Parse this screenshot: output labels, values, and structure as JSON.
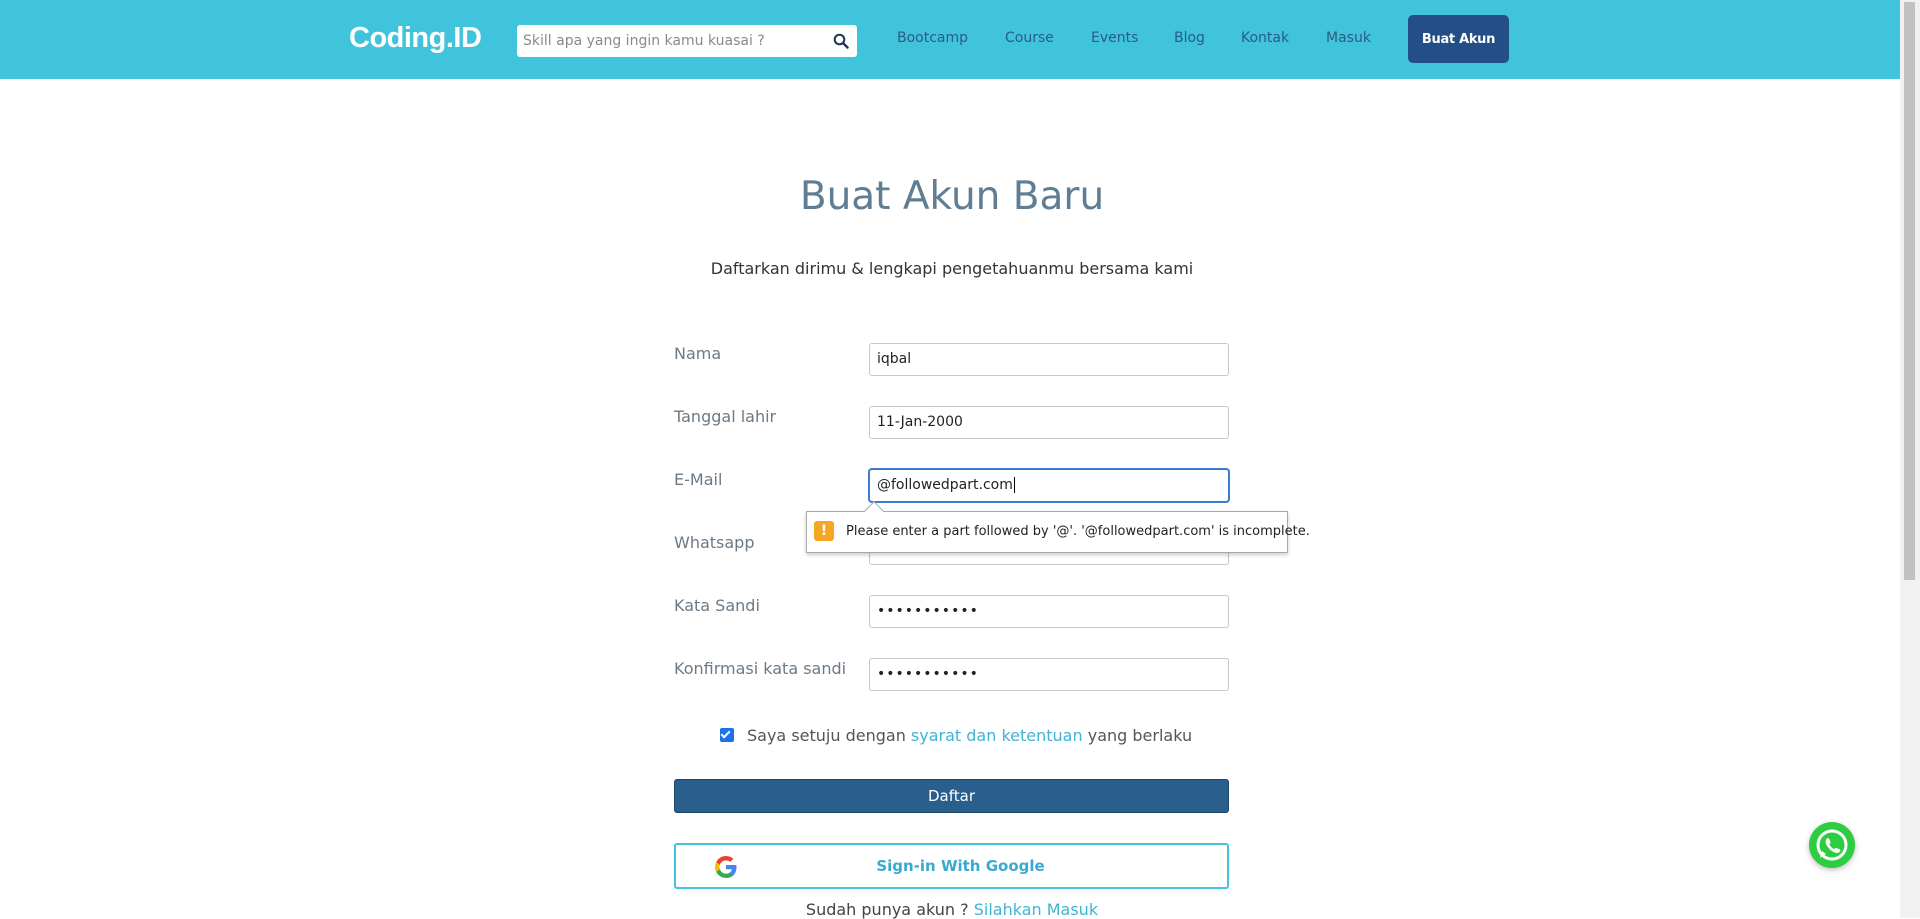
{
  "header": {
    "logo": "Coding.ID",
    "search_placeholder": "Skill apa yang ingin kamu kuasai ?",
    "nav": [
      "Bootcamp",
      "Course",
      "Events",
      "Blog",
      "Kontak",
      "Masuk"
    ],
    "cta": "Buat Akun"
  },
  "main": {
    "title": "Buat Akun Baru",
    "subtitle": "Daftarkan dirimu & lengkapi pengetahuanmu bersama kami",
    "fields": [
      {
        "label": "Nama",
        "value": "iqbal"
      },
      {
        "label": "Tanggal lahir",
        "value": "11-Jan-2000"
      },
      {
        "label": "E-Mail",
        "value": "@followedpart.com"
      },
      {
        "label": "Whatsapp",
        "value": ""
      },
      {
        "label": "Kata Sandi",
        "value": "•••••••••••"
      },
      {
        "label": "Konfirmasi kata sandi",
        "value": "•••••••••••"
      }
    ],
    "validation_tooltip": "Please enter a part followed by '@'. '@followedpart.com' is incomplete.",
    "agree": {
      "prefix": "Saya setuju dengan",
      "link": "syarat dan ketentuan",
      "suffix": "yang berlaku",
      "checked": true
    },
    "submit_label": "Daftar",
    "google_label": "Sign-in With Google",
    "login_prompt": "Sudah punya akun ?",
    "login_link": "Silahkan Masuk"
  },
  "icons": {
    "search": "search-icon",
    "warning": "warning-icon",
    "google": "google-icon",
    "whatsapp": "whatsapp-icon"
  },
  "colors": {
    "header_bg": "#40c4dc",
    "primary_dark": "#234f86",
    "submit_bg": "#2a5e8c",
    "link": "#40b4d4",
    "title": "#5f7d93"
  }
}
